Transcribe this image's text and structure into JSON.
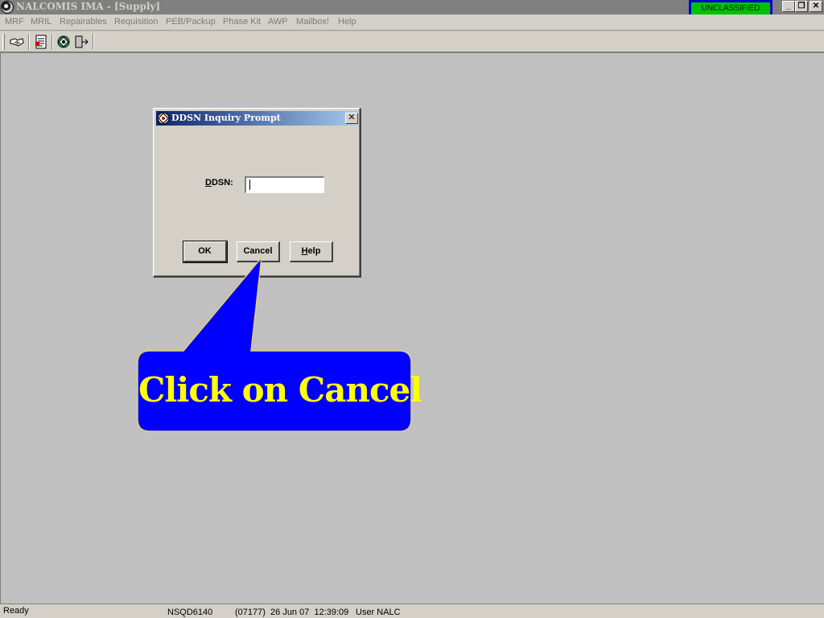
{
  "titlebar": {
    "title": "NALCOMIS IMA - [Supply]",
    "classification": "UNCLASSIFIED",
    "min_glyph": "_",
    "restore_glyph": "❐",
    "close_glyph": "✕"
  },
  "menubar": {
    "items": [
      "MRF",
      "MRIL",
      "Repairables",
      "Requisition",
      "PEB/Packup",
      "Phase Kit",
      "AWP",
      "Mailbox!",
      "Help"
    ]
  },
  "toolbar": {
    "icons": [
      "handshake-icon",
      "document-list-icon",
      "globe-icon",
      "exit-door-icon"
    ]
  },
  "dialog": {
    "title": "DDSN Inquiry Prompt",
    "close_glyph": "✕",
    "field_label_first": "D",
    "field_label_rest": "DSN:",
    "field_value": "",
    "ok_label": "OK",
    "cancel_label": "Cancel",
    "help_first": "H",
    "help_rest": "elp"
  },
  "callout": {
    "text": "Click on Cancel",
    "fill_color": "#0000ff",
    "text_color": "#ffff00"
  },
  "statusbar": {
    "status": "Ready",
    "workstation": "NSQD6140",
    "datetime": "(07177)  26 Jun 07  12:39:09",
    "user": "User NALC"
  }
}
